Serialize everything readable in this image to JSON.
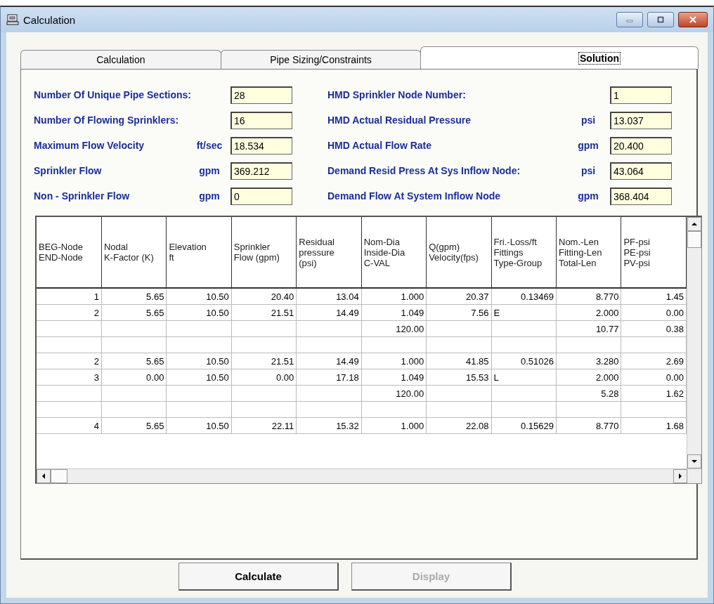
{
  "window": {
    "title": "Calculation"
  },
  "tabs": [
    {
      "label": "Calculation",
      "selected": false
    },
    {
      "label": "Pipe Sizing/Constraints",
      "selected": false
    },
    {
      "label": "Solution",
      "selected": true
    }
  ],
  "left_fields": [
    {
      "label": "Number Of Unique Pipe Sections:",
      "value": "28"
    },
    {
      "label": "Number Of Flowing Sprinklers:",
      "value": "16"
    },
    {
      "label": "Maximum Flow Velocity",
      "unit": "ft/sec",
      "value": "18.534"
    },
    {
      "label": "Sprinkler Flow",
      "unit": "gpm",
      "value": "369.212"
    },
    {
      "label": "Non - Sprinkler Flow",
      "unit": "gpm",
      "value": "0"
    }
  ],
  "right_fields": [
    {
      "label": "HMD Sprinkler Node Number:",
      "value": "1"
    },
    {
      "label": "HMD Actual Residual Pressure",
      "unit": "psi",
      "value": "13.037"
    },
    {
      "label": "HMD Actual Flow Rate",
      "unit": "gpm",
      "value": "20.400"
    },
    {
      "label": "Demand Resid Press At Sys Inflow Node:",
      "unit": "psi",
      "value": "43.064"
    },
    {
      "label": "Demand Flow At System Inflow Node",
      "unit": "gpm",
      "value": "368.404"
    }
  ],
  "table": {
    "columns": [
      {
        "lines": [
          "BEG-Node",
          "END-Node"
        ]
      },
      {
        "lines": [
          "Nodal",
          "K-Factor (K)"
        ]
      },
      {
        "lines": [
          "Elevation",
          "ft"
        ]
      },
      {
        "lines": [
          "Sprinkler",
          "Flow (gpm)"
        ]
      },
      {
        "lines": [
          "Residual",
          "pressure",
          "(psi)"
        ]
      },
      {
        "lines": [
          "Nom-Dia",
          "Inside-Dia",
          "C-VAL"
        ]
      },
      {
        "lines": [
          "Q(gpm)",
          "Velocity(fps)"
        ]
      },
      {
        "lines": [
          "Fri.-Loss/ft",
          "Fittings",
          "Type-Group"
        ]
      },
      {
        "lines": [
          "Nom.-Len",
          "Fitting-Len",
          "Total-Len"
        ]
      },
      {
        "lines": [
          "PF-psi",
          "PE-psi",
          "PV-psi"
        ]
      }
    ],
    "rows": [
      {
        "kind": "data",
        "cells": [
          "1",
          "5.65",
          "10.50",
          "20.40",
          "13.04",
          "1.000",
          "20.37",
          "0.13469",
          "8.770",
          "1.45"
        ]
      },
      {
        "kind": "data",
        "cells": [
          "2",
          "5.65",
          "10.50",
          "21.51",
          "14.49",
          "1.049",
          "7.56",
          null,
          "2.000",
          "0.00"
        ],
        "fitting": "E"
      },
      {
        "kind": "data",
        "cells": [
          null,
          null,
          null,
          null,
          null,
          "120.00",
          null,
          null,
          "10.77",
          "0.38"
        ]
      },
      {
        "kind": "blank"
      },
      {
        "kind": "data",
        "cells": [
          "2",
          "5.65",
          "10.50",
          "21.51",
          "14.49",
          "1.000",
          "41.85",
          "0.51026",
          "3.280",
          "2.69"
        ]
      },
      {
        "kind": "data",
        "cells": [
          "3",
          "0.00",
          "10.50",
          "0.00",
          "17.18",
          "1.049",
          "15.53",
          null,
          "2.000",
          "0.00"
        ],
        "fitting": "L"
      },
      {
        "kind": "data",
        "cells": [
          null,
          null,
          null,
          null,
          null,
          "120.00",
          null,
          null,
          "5.28",
          "1.62"
        ]
      },
      {
        "kind": "blank"
      },
      {
        "kind": "data",
        "cells": [
          "4",
          "5.65",
          "10.50",
          "22.11",
          "15.32",
          "1.000",
          "22.08",
          "0.15629",
          "8.770",
          "1.68"
        ]
      }
    ]
  },
  "buttons": [
    {
      "label": "Calculate",
      "disabled": false
    },
    {
      "label": "Display",
      "disabled": true
    }
  ]
}
